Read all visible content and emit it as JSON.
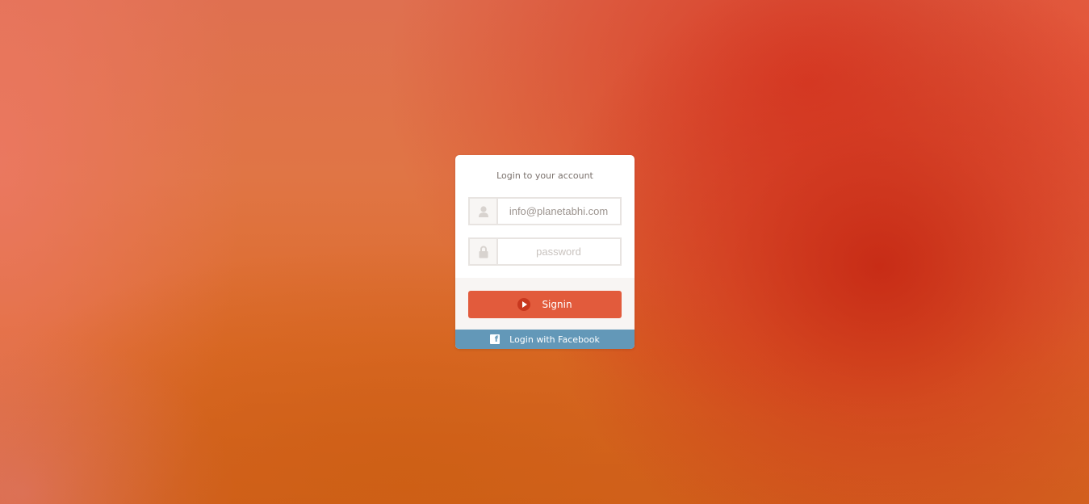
{
  "login": {
    "title": "Login to your account",
    "email": {
      "value": "",
      "placeholder": "info@planetabhi.com",
      "icon": "user-icon"
    },
    "password": {
      "value": "",
      "placeholder": "password",
      "icon": "lock-icon"
    },
    "signin_label": "Signin",
    "signin_icon": "play-icon",
    "facebook_label": "Login with Facebook",
    "facebook_icon": "facebook-icon",
    "facebook_icon_glyph": "f"
  },
  "colors": {
    "accent": "#e25b3c",
    "facebook": "#6398b8",
    "background": "#e07545"
  }
}
